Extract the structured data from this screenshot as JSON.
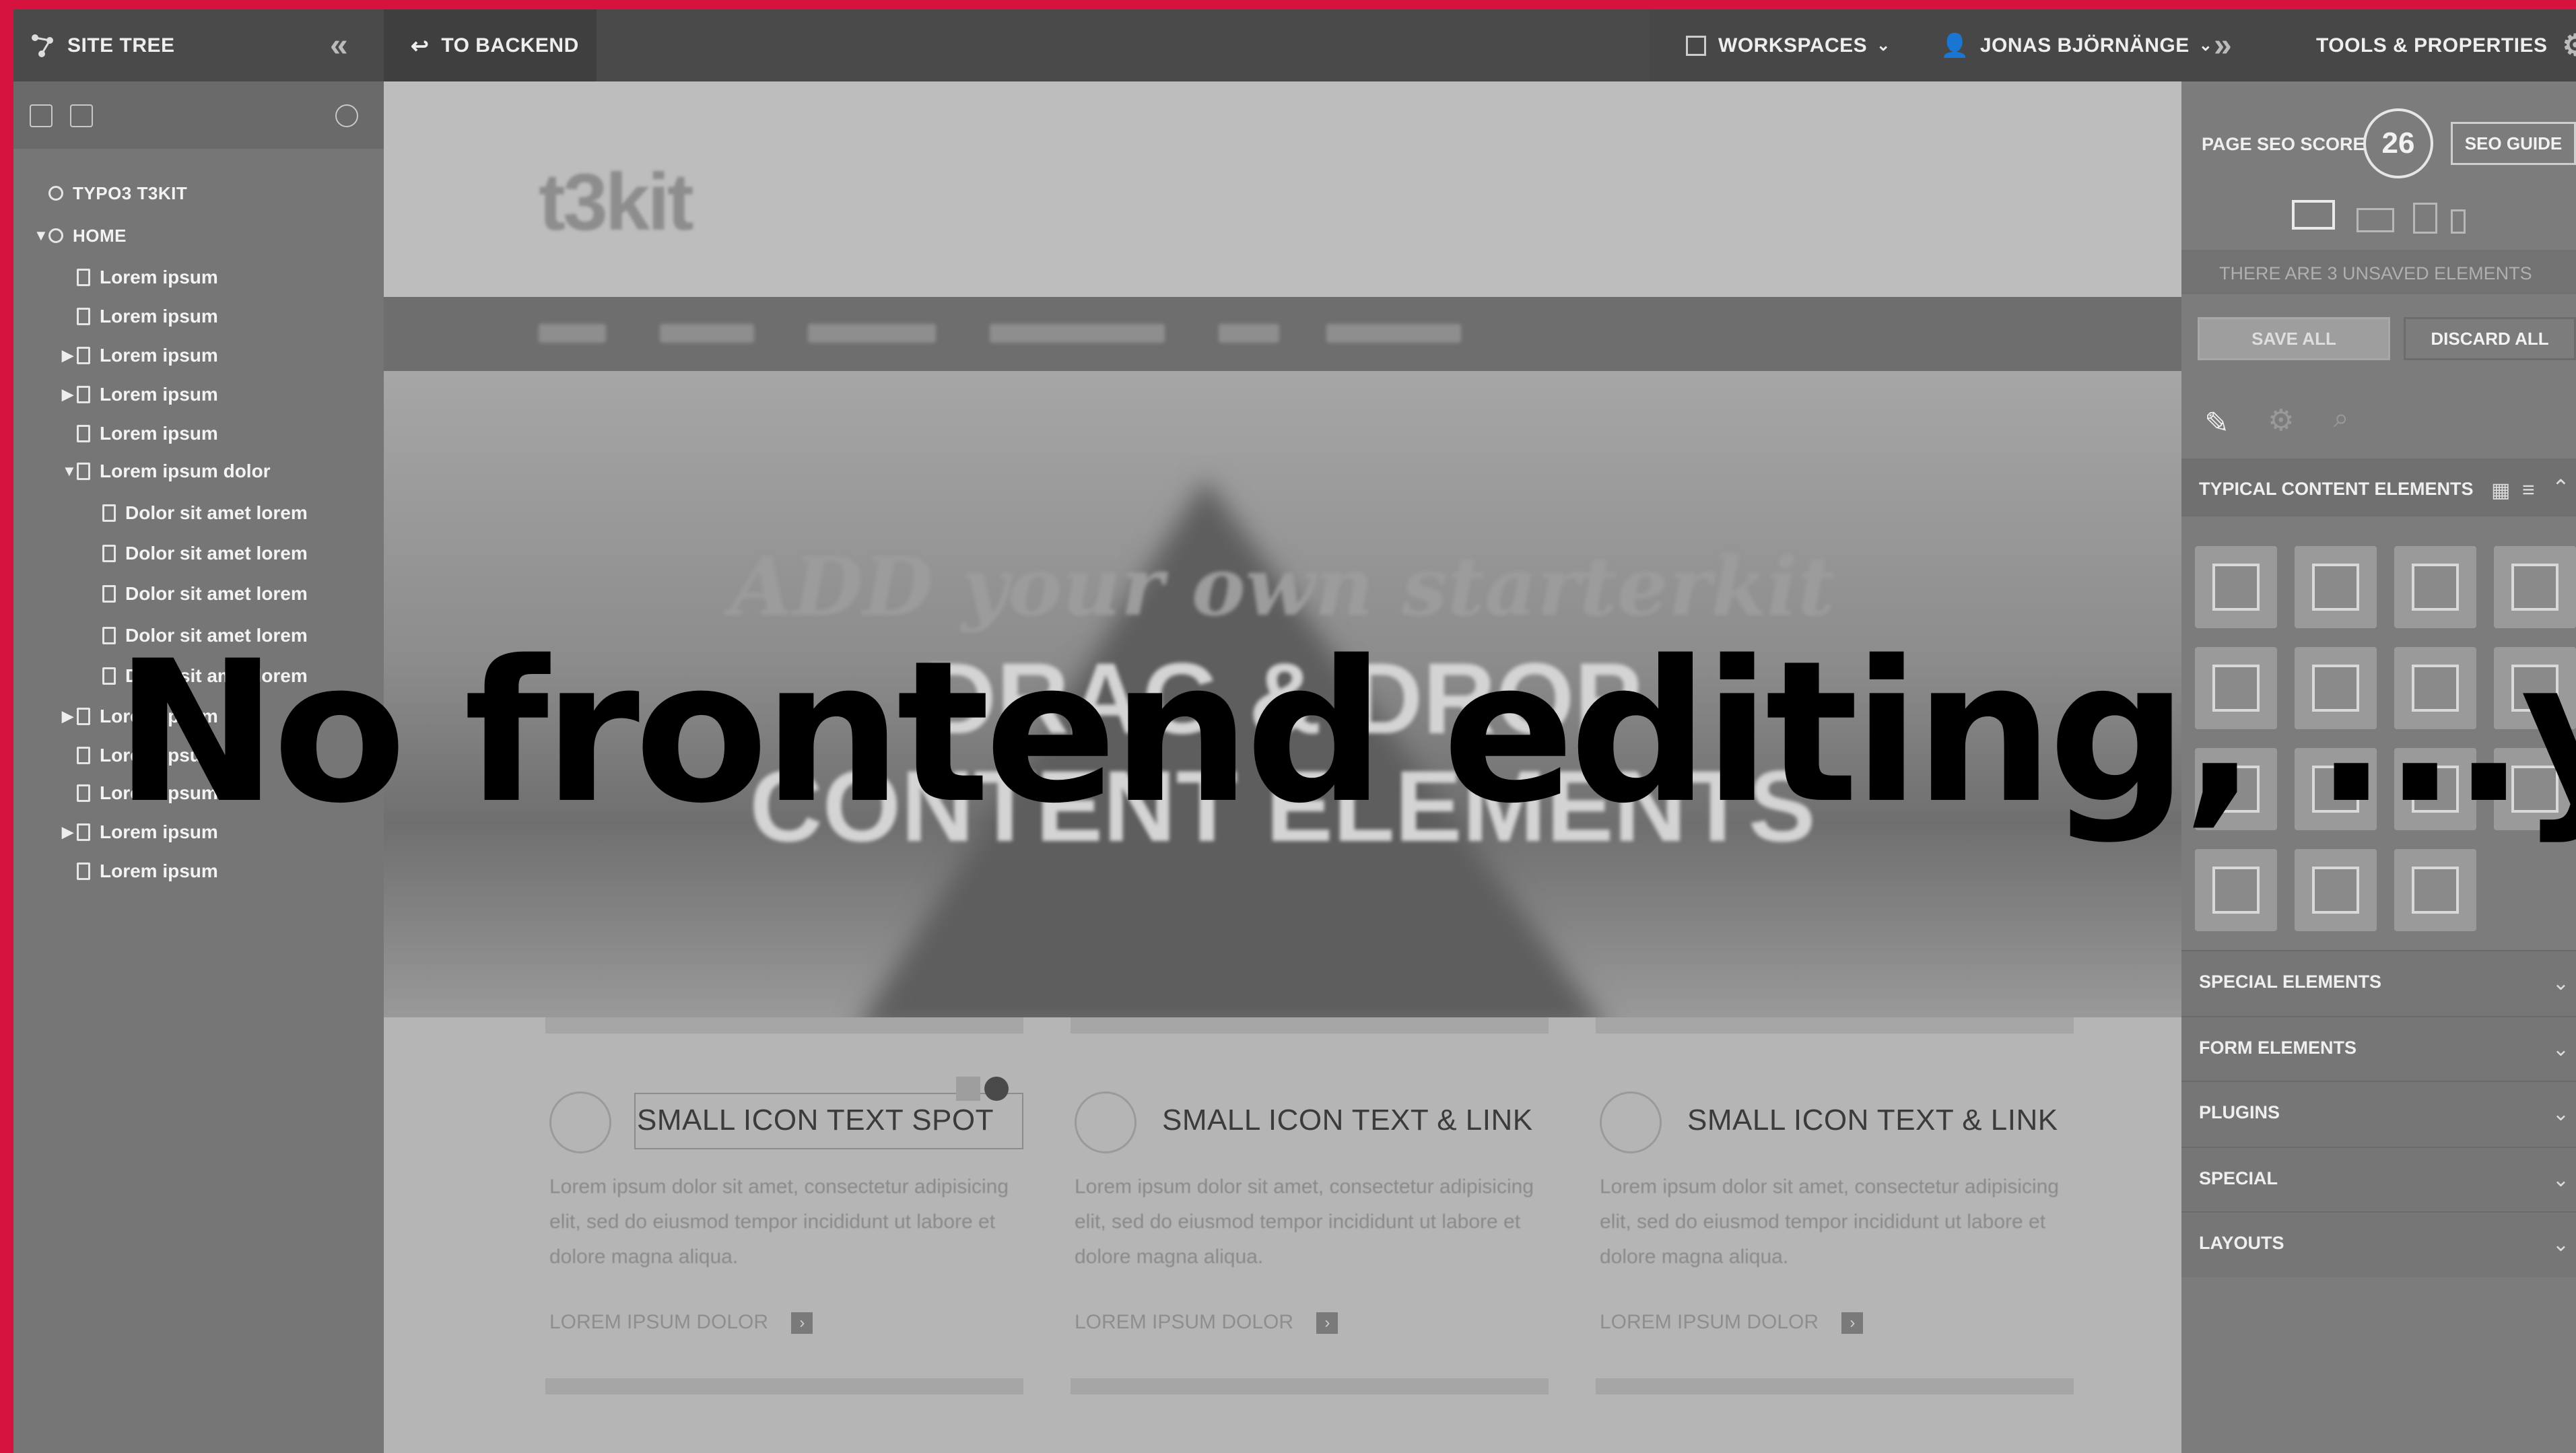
{
  "colors": {
    "accent_border": "#d6133f",
    "topbar": "#4a4a4a",
    "overlay_text": "#000000"
  },
  "topbar": {
    "site_tree_label": "SITE TREE",
    "to_backend_label": "TO BACKEND",
    "workspaces_label": "WORKSPACES",
    "user_label": "JONAS BJÖRNÄNGE",
    "tools_label": "TOOLS & PROPERTIES",
    "icons": [
      "sitetree-icon",
      "collapse-left-icon",
      "back-arrow-icon",
      "workspaces-icon",
      "user-icon",
      "expand-right-icon",
      "gear-icon"
    ]
  },
  "sidebar": {
    "tree": [
      {
        "label": "TYPO3 T3KIT",
        "level": 0,
        "caret": ""
      },
      {
        "label": "HOME",
        "level": 0,
        "caret": "▼"
      },
      {
        "label": "Lorem ipsum",
        "level": 1,
        "caret": ""
      },
      {
        "label": "Lorem ipsum",
        "level": 1,
        "caret": ""
      },
      {
        "label": "Lorem ipsum",
        "level": 1,
        "caret": "▶"
      },
      {
        "label": "Lorem ipsum",
        "level": 1,
        "caret": "▶"
      },
      {
        "label": "Lorem ipsum",
        "level": 1,
        "caret": ""
      },
      {
        "label": "Lorem ipsum dolor",
        "level": 1,
        "caret": "▼"
      },
      {
        "label": "Dolor sit amet lorem",
        "level": 2,
        "caret": ""
      },
      {
        "label": "Dolor sit amet lorem",
        "level": 2,
        "caret": ""
      },
      {
        "label": "Dolor sit amet lorem",
        "level": 2,
        "caret": ""
      },
      {
        "label": "Dolor sit amet lorem",
        "level": 2,
        "caret": ""
      },
      {
        "label": "Dolor sit amet lorem",
        "level": 2,
        "caret": ""
      },
      {
        "label": "Lorem ipsum",
        "level": 1,
        "caret": "▶"
      },
      {
        "label": "Lorem ipsum",
        "level": 1,
        "caret": ""
      },
      {
        "label": "Lorem ipsum",
        "level": 1,
        "caret": ""
      },
      {
        "label": "Lorem ipsum",
        "level": 1,
        "caret": "▶"
      },
      {
        "label": "Lorem ipsum",
        "level": 1,
        "caret": ""
      }
    ]
  },
  "preview": {
    "logo": "t3kit",
    "hero_script": "ADD your own starterkit",
    "hero_line1": "DRAG & DROP",
    "hero_line2": "CONTENT ELEMENTS",
    "cards": [
      {
        "title": "SMALL ICON TEXT SPOT",
        "body": "Lorem ipsum dolor sit amet, consectetur adipisicing elit, sed do eiusmod tempor incididunt ut labore et dolore magna aliqua.",
        "link": "LOREM IPSUM DOLOR"
      },
      {
        "title": "SMALL ICON TEXT & LINK",
        "body": "Lorem ipsum dolor sit amet, consectetur adipisicing elit, sed do eiusmod tempor incididunt ut labore et dolore magna aliqua.",
        "link": "LOREM IPSUM DOLOR"
      },
      {
        "title": "SMALL ICON TEXT & LINK",
        "body": "Lorem ipsum dolor sit amet, consectetur adipisicing elit, sed do eiusmod tempor incididunt ut labore et dolore magna aliqua.",
        "link": "LOREM IPSUM DOLOR"
      }
    ]
  },
  "rpanel": {
    "seo_label": "PAGE SEO SCORE",
    "seo_score": "26",
    "seo_guide": "SEO GUIDE",
    "unsaved_text": "THERE ARE 3 UNSAVED ELEMENTS",
    "save_all": "SAVE ALL",
    "discard_all": "DISCARD ALL",
    "typical_header": "TYPICAL CONTENT ELEMENTS",
    "sections": [
      "SPECIAL ELEMENTS",
      "FORM ELEMENTS",
      "PLUGINS",
      "SPECIAL",
      "LAYOUTS"
    ]
  },
  "overlay": {
    "text": "No frontend editing, ...yet"
  }
}
